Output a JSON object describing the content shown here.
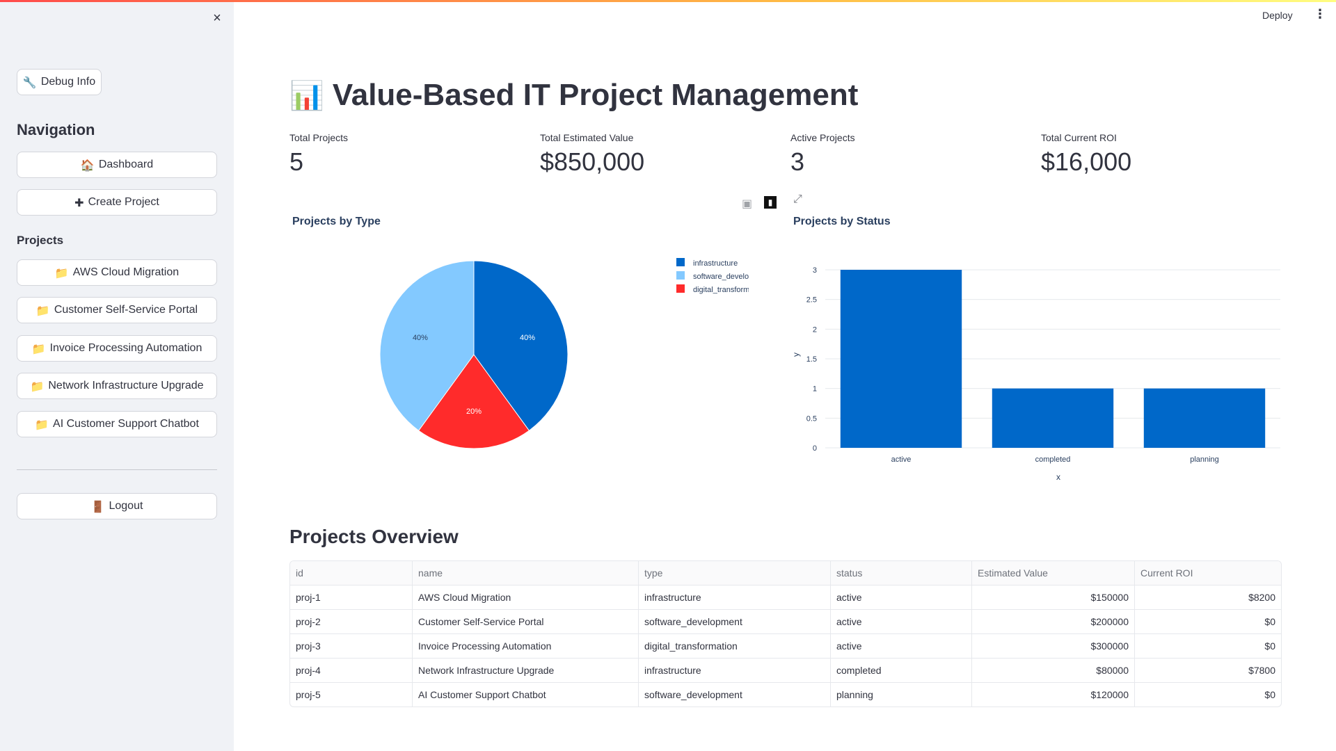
{
  "sidebar": {
    "close_icon": "×",
    "debug_button": {
      "icon": "🔧",
      "label": "Debug Info"
    },
    "navigation_heading": "Navigation",
    "nav_items": [
      {
        "icon": "🏠",
        "label": "Dashboard"
      },
      {
        "icon": "✚",
        "label": "Create Project"
      }
    ],
    "projects_heading": "Projects",
    "projects": [
      {
        "icon": "📁",
        "label": "AWS Cloud Migration"
      },
      {
        "icon": "📁",
        "label": "Customer Self-Service Portal"
      },
      {
        "icon": "📁",
        "label": "Invoice Processing Automation"
      },
      {
        "icon": "📁",
        "label": "Network Infrastructure Upgrade"
      },
      {
        "icon": "📁",
        "label": "AI Customer Support Chatbot"
      }
    ],
    "logout": {
      "icon": "🚪",
      "label": "Logout"
    }
  },
  "header": {
    "deploy_label": "Deploy",
    "menu_icon": "⋮"
  },
  "page": {
    "title_icon": "📊",
    "title": "Value-Based IT Project Management"
  },
  "metrics": [
    {
      "label": "Total Projects",
      "value": "5"
    },
    {
      "label": "Total Estimated Value",
      "value": "$850,000"
    },
    {
      "label": "Active Projects",
      "value": "3"
    },
    {
      "label": "Total Current ROI",
      "value": "$16,000"
    }
  ],
  "colors": {
    "infrastructure": "#0068c9",
    "software_development": "#83c9ff",
    "digital_transformation": "#ff2b2b",
    "bar": "#0068c9"
  },
  "chart_data": [
    {
      "type": "pie",
      "title": "Projects by Type",
      "labels": [
        "infrastructure",
        "software_development",
        "digital_transformation"
      ],
      "values": [
        2,
        2,
        1
      ],
      "percent_labels": [
        "40%",
        "40%",
        "20%"
      ],
      "legend": "top-right"
    },
    {
      "type": "bar",
      "title": "Projects by Status",
      "categories": [
        "active",
        "completed",
        "planning"
      ],
      "values": [
        3,
        1,
        1
      ],
      "xlabel": "x",
      "ylabel": "y",
      "ylim": [
        0,
        3
      ],
      "yticks": [
        "0",
        "0.5",
        "1",
        "1.5",
        "2",
        "2.5",
        "3"
      ],
      "grid": true
    }
  ],
  "table": {
    "title": "Projects Overview",
    "columns": [
      "id",
      "name",
      "type",
      "status",
      "Estimated Value",
      "Current ROI"
    ],
    "rows": [
      [
        "proj-1",
        "AWS Cloud Migration",
        "infrastructure",
        "active",
        "$150000",
        "$8200"
      ],
      [
        "proj-2",
        "Customer Self-Service Portal",
        "software_development",
        "active",
        "$200000",
        "$0"
      ],
      [
        "proj-3",
        "Invoice Processing Automation",
        "digital_transformation",
        "active",
        "$300000",
        "$0"
      ],
      [
        "proj-4",
        "Network Infrastructure Upgrade",
        "infrastructure",
        "completed",
        "$80000",
        "$7800"
      ],
      [
        "proj-5",
        "AI Customer Support Chatbot",
        "software_development",
        "planning",
        "$120000",
        "$0"
      ]
    ]
  }
}
